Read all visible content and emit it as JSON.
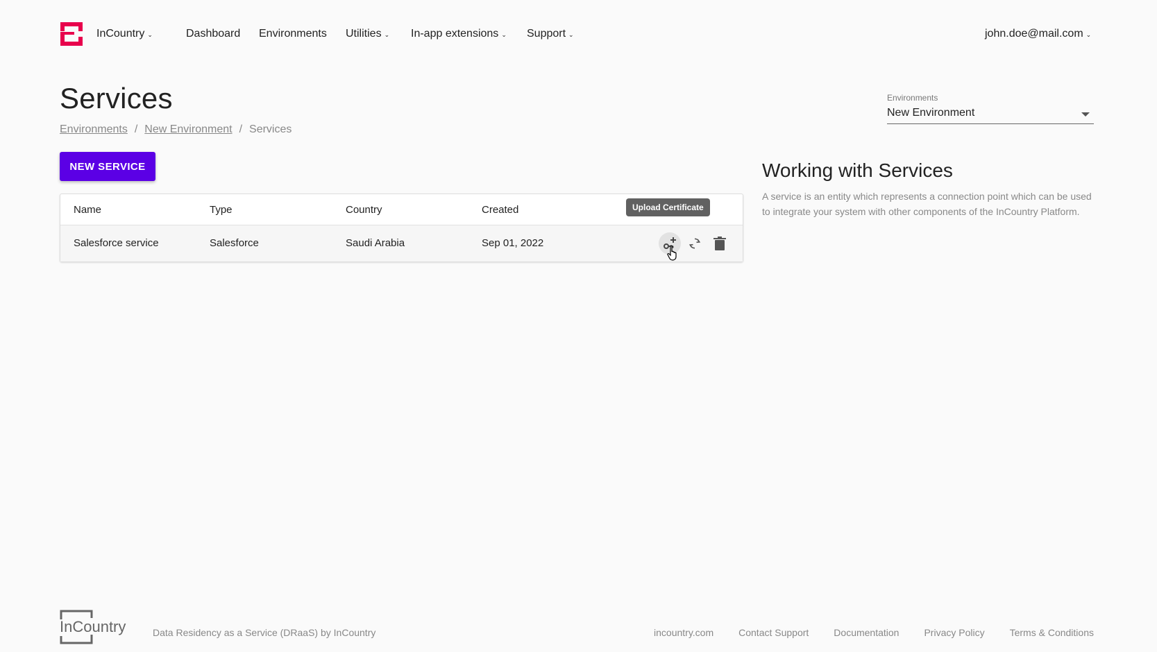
{
  "nav": {
    "org": "InCountry",
    "items": [
      "Dashboard",
      "Environments"
    ],
    "dropdowns": [
      "Utilities",
      "In-app extensions",
      "Support"
    ],
    "user": "john.doe@mail.com"
  },
  "page": {
    "title": "Services",
    "breadcrumb": [
      "Environments",
      "New Environment",
      "Services"
    ]
  },
  "env_select": {
    "label": "Environments",
    "value": "New Environment"
  },
  "new_button": "NEW SERVICE",
  "table": {
    "columns": [
      "Name",
      "Type",
      "Country",
      "Created"
    ],
    "rows": [
      {
        "name": "Salesforce service",
        "type": "Salesforce",
        "country": "Saudi Arabia",
        "created": "Sep 01, 2022"
      }
    ],
    "tooltip": "Upload Certificate",
    "action_icons": [
      "upload-certificate-icon",
      "refresh-icon",
      "delete-icon"
    ]
  },
  "info": {
    "title": "Working with Services",
    "text": "A service is an entity which represents a connection point which can be used to integrate your system with other components of the InCountry Platform."
  },
  "footer": {
    "logo_text": "InCountry",
    "tagline": "Data Residency as a Service (DRaaS) by InCountry",
    "links": [
      "incountry.com",
      "Contact Support",
      "Documentation",
      "Privacy Policy",
      "Terms & Conditions"
    ]
  },
  "colors": {
    "brand": "#e8004c",
    "primary_button": "#5b00e5"
  }
}
